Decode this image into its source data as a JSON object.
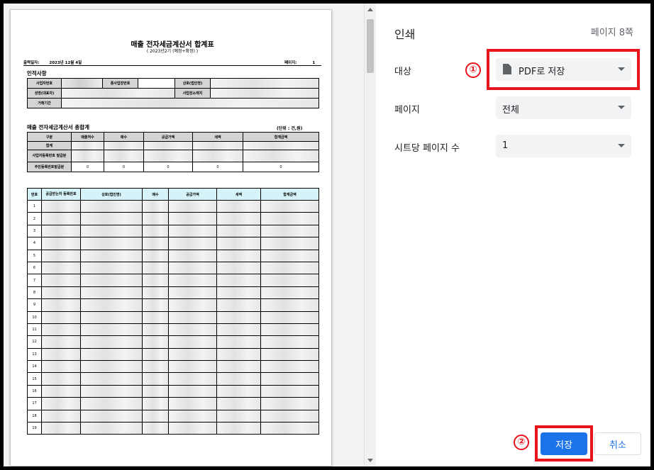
{
  "report": {
    "title": "매출 전자세금계산서 합계표",
    "subtitle": "( 2023년2기 (예정+확정) )",
    "print_date_label": "출력일자:",
    "print_date": "2023년 12월 4일",
    "page_label": "페이지:",
    "page_number": "1",
    "person_section": {
      "title": "인적사항",
      "labels": [
        "사업자번호",
        "종사업장번호",
        "상호(법인명)",
        "성명(대표자)",
        "사업장소재지",
        "거래기간"
      ]
    },
    "summary_section": {
      "title": "매출 전자세금계산서 총합계",
      "unit": "(단위 : 건,원)",
      "headers": [
        "구분",
        "매출처수",
        "매수",
        "공급가액",
        "세액",
        "합계금액"
      ],
      "row_labels": [
        "합계",
        "사업자등록번호 발급분",
        "주민등록번호발급분"
      ],
      "resident_values": [
        "0",
        "0",
        "0",
        "0",
        "0"
      ]
    },
    "detail_table": {
      "headers": [
        "번호",
        "공급받는자 등록번호",
        "상호(법인명)",
        "매수",
        "공급가액",
        "세액",
        "합계금액"
      ],
      "row_numbers": [
        "1",
        "2",
        "3",
        "4",
        "5",
        "6",
        "7",
        "8",
        "9",
        "10",
        "11",
        "12",
        "13",
        "14",
        "15",
        "16",
        "17",
        "18",
        "19"
      ]
    }
  },
  "panel": {
    "title": "인쇄",
    "page_count": "페이지 8쪽",
    "destination_label": "대상",
    "destination_value": "PDF로 저장",
    "destination_icon": "document-icon",
    "pages_label": "페이지",
    "pages_value": "전체",
    "sheets_label": "시트당 페이지 수",
    "sheets_value": "1",
    "save_button": "저장",
    "cancel_button": "취소"
  },
  "annotations": {
    "marker_1": "①",
    "marker_2": "②",
    "color": "#e8141b"
  },
  "colors": {
    "primary_button": "#1a73e8",
    "select_background": "#f1f3f4",
    "detail_header": "#d5f3f8"
  }
}
